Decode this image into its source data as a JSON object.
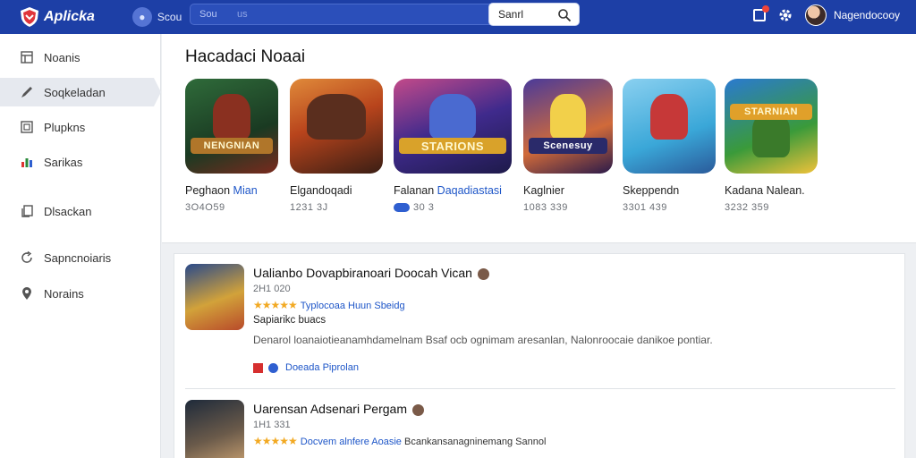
{
  "topbar": {
    "app_name": "Aplicka",
    "scope_label": "Scou",
    "search_hint": "Sou",
    "search_hint_secondary": "us",
    "search_value": "Sanrl",
    "username": "Nagendocooy",
    "accent": "#1d3fa6"
  },
  "sidebar": {
    "items": [
      {
        "label": "Noanis",
        "icon": "home-icon",
        "active": false
      },
      {
        "label": "Soqkeladan",
        "icon": "pen-icon",
        "active": true
      },
      {
        "label": "Plupkns",
        "icon": "grid-icon",
        "active": false
      },
      {
        "label": "Sarikas",
        "icon": "chart-icon",
        "active": false
      },
      {
        "label": "Dlsackan",
        "icon": "copy-icon",
        "active": false
      },
      {
        "label": "Sapncnoiaris",
        "icon": "refresh-icon",
        "active": false
      },
      {
        "label": "Norains",
        "icon": "pin-icon",
        "active": false
      }
    ]
  },
  "featured": {
    "title": "Hacadaci Noaai",
    "apps": [
      {
        "name": "Peghaon",
        "name_link": "Mian",
        "meta": "3O4O59",
        "banner": "NENGNIAN",
        "colors": [
          "#2f6b3a",
          "#7a2a1e",
          "#c9a03a"
        ]
      },
      {
        "name": "Elgandoqadi",
        "name_link": "",
        "meta": "1231 3J",
        "banner": "",
        "colors": [
          "#b8441c",
          "#5a2e1e",
          "#e08a3a"
        ]
      },
      {
        "name": "Falanan",
        "name_link": "Daqadiastasi",
        "meta": "30 3",
        "badge": "00",
        "banner": "STARIONS",
        "colors": [
          "#3f2a8c",
          "#c34a8a",
          "#e2b43a"
        ]
      },
      {
        "name": "Kaglnier",
        "name_link": "",
        "meta": "1083 339",
        "banner": "Scenesuy",
        "colors": [
          "#4a3a9a",
          "#d06a3a",
          "#f2d04a"
        ]
      },
      {
        "name": "Skeppendn",
        "name_link": "",
        "meta": "3301 439",
        "banner": "",
        "colors": [
          "#3aa7d8",
          "#c63838",
          "#f2c44a"
        ]
      },
      {
        "name": "Kadana Nalean.",
        "name_link": "",
        "meta": "3232 359",
        "banner": "STARNIAN",
        "colors": [
          "#2a7ad0",
          "#3a9a3a",
          "#f0c23a"
        ]
      }
    ]
  },
  "list": {
    "rows": [
      {
        "title": "Ualianbo Dovapbiranoari Doocah Vican",
        "sub": "2H1 020",
        "stars": "★★★★★",
        "link": "Typlocoaa Huun Sbeidg",
        "category": "Sapiarikc buacs",
        "desc": "Denarol loanaiotieanamhdamelnam Bsaf ocb ognimam aresanlan, Nalonroocaie danikoe pontiar.",
        "publisher": "Doeada Piprolan",
        "thumb_colors": [
          "#2a4a8a",
          "#d2a23a",
          "#b84a2a"
        ]
      },
      {
        "title": "Uarensan Adsenari Pergam",
        "sub": "1H1 331",
        "stars": "★★★★★",
        "link": "Docvem alnfere Aoasie",
        "link_extra": "Bcankansanagninemang Sannol",
        "category": "",
        "desc": "",
        "publisher": "",
        "thumb_colors": [
          "#1e2a3a",
          "#6a5a4a",
          "#c9a070"
        ]
      }
    ]
  }
}
